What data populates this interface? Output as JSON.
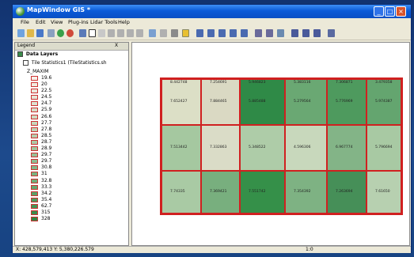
{
  "window": {
    "title": "MapWindow GIS *"
  },
  "menu": [
    "File",
    "Edit",
    "View",
    "Plug-ins",
    "Lidar Tools",
    "Help"
  ],
  "legend": {
    "title": "Legend",
    "close": "X",
    "group": "Data Layers",
    "layer": "Tile Statistics1 (TileStatistics.sh",
    "field": "Z_MAXIM",
    "items": [
      {
        "label": "19.6",
        "color": "#f7efe8"
      },
      {
        "label": "20",
        "color": "#f1ece1"
      },
      {
        "label": "22.5",
        "color": "#ebe8dc"
      },
      {
        "label": "24.5",
        "color": "#e5e4d6"
      },
      {
        "label": "24.7",
        "color": "#dee1d0"
      },
      {
        "label": "25.9",
        "color": "#d6ddc9"
      },
      {
        "label": "26.6",
        "color": "#cfdac2"
      },
      {
        "label": "27.7",
        "color": "#c7d6bb"
      },
      {
        "label": "27.8",
        "color": "#bed1b4"
      },
      {
        "label": "28.5",
        "color": "#b5ccad"
      },
      {
        "label": "28.7",
        "color": "#acc8a5"
      },
      {
        "label": "28.9",
        "color": "#a2c39e"
      },
      {
        "label": "29.7",
        "color": "#98bf97"
      },
      {
        "label": "29.7",
        "color": "#8eba90"
      },
      {
        "label": "30.8",
        "color": "#85b588"
      },
      {
        "label": "31",
        "color": "#7bb180"
      },
      {
        "label": "32.8",
        "color": "#70ab78"
      },
      {
        "label": "33.3",
        "color": "#66a670"
      },
      {
        "label": "34.2",
        "color": "#5b9f67"
      },
      {
        "label": "35.4",
        "color": "#50995e"
      },
      {
        "label": "62.7",
        "color": "#459355"
      },
      {
        "label": "315",
        "color": "#3a8b4b"
      },
      {
        "label": "328",
        "color": "#2f8443"
      }
    ]
  },
  "grid": {
    "rows": [
      [
        {
          "top": "8.442748",
          "mid": "7.652427",
          "color": "#dcdfc6"
        },
        {
          "top": "7.254691",
          "mid": "7.884465",
          "color": "#dad9c3"
        },
        {
          "top": "5.946823",
          "mid": "5.885488",
          "color": "#2f8a47"
        },
        {
          "top": "5.383116",
          "mid": "5.279564",
          "color": "#6aa873"
        },
        {
          "top": "7.306871",
          "mid": "5.776969",
          "color": "#4e9a5e"
        },
        {
          "top": "3.479358",
          "mid": "5.974387",
          "color": "#64a56f"
        }
      ],
      [
        {
          "top": "",
          "mid": "7.513442",
          "color": "#a5c8a0"
        },
        {
          "top": "",
          "mid": "7.332863",
          "color": "#dadcc7"
        },
        {
          "top": "",
          "mid": "5.348522",
          "color": "#aecca8"
        },
        {
          "top": "",
          "mid": "4.596306",
          "color": "#c8d8bc"
        },
        {
          "top": "",
          "mid": "6.967774",
          "color": "#83b487"
        },
        {
          "top": "",
          "mid": "5.796694",
          "color": "#a8c9a3"
        }
      ],
      [
        {
          "top": "",
          "mid": "7.74335",
          "color": "#a9caa4"
        },
        {
          "top": "",
          "mid": "7.369421",
          "color": "#78af7e"
        },
        {
          "top": "",
          "mid": "7.551742",
          "color": "#359049"
        },
        {
          "top": "",
          "mid": "7.354392",
          "color": "#7eb283"
        },
        {
          "top": "",
          "mid": "7.263694",
          "color": "#468f58"
        },
        {
          "top": "",
          "mid": "7.61650",
          "color": "#b7d0b0"
        }
      ]
    ]
  },
  "status": {
    "coords": "X: 428,579,413 Y: 5,380,226.579",
    "scale": "1:0"
  },
  "colors": {
    "titlebar": "#0b5bd8",
    "grid_border": "#d02020"
  }
}
